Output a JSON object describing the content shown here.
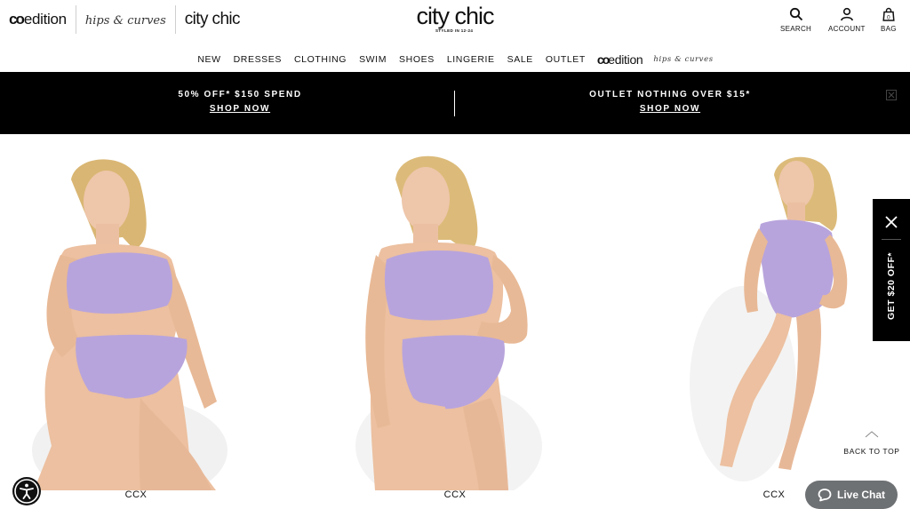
{
  "header": {
    "brand_switcher": {
      "coedition_mark": "co",
      "coedition": "edition",
      "hips_curves": "hips & curves",
      "city_chic": "city chic"
    },
    "logo": {
      "text": "city chic",
      "tagline": "STYLED IN 12-24"
    },
    "utilities": {
      "search": "SEARCH",
      "account": "ACCOUNT",
      "bag": "BAG",
      "bag_count": "0"
    }
  },
  "nav": {
    "items": [
      "NEW",
      "DRESSES",
      "CLOTHING",
      "SWIM",
      "SHOES",
      "LINGERIE",
      "SALE",
      "OUTLET"
    ],
    "coedition_mark": "co",
    "coedition": "edition",
    "hips_curves": "hips & curves"
  },
  "promo": {
    "left": {
      "title": "50% OFF* $150 SPEND",
      "link": "SHOP NOW"
    },
    "right": {
      "title": "OUTLET NOTHING OVER $15*",
      "link": "SHOP NOW"
    }
  },
  "products": [
    {
      "brand": "CCX",
      "image": "model-lilac-crop-bikini-high-waist-brief"
    },
    {
      "brand": "CCX",
      "image": "model-lilac-crop-bikini-front"
    },
    {
      "brand": "CCX",
      "image": "model-lilac-one-shoulder-swimsuit"
    }
  ],
  "side_tab": {
    "label": "GET $20 OFF*"
  },
  "back_to_top": "BACK TO TOP",
  "live_chat": "Live Chat",
  "colors": {
    "promo_bg": "#000000",
    "swimwear": "#b8a4dc",
    "chat_bg": "#6e7174"
  }
}
